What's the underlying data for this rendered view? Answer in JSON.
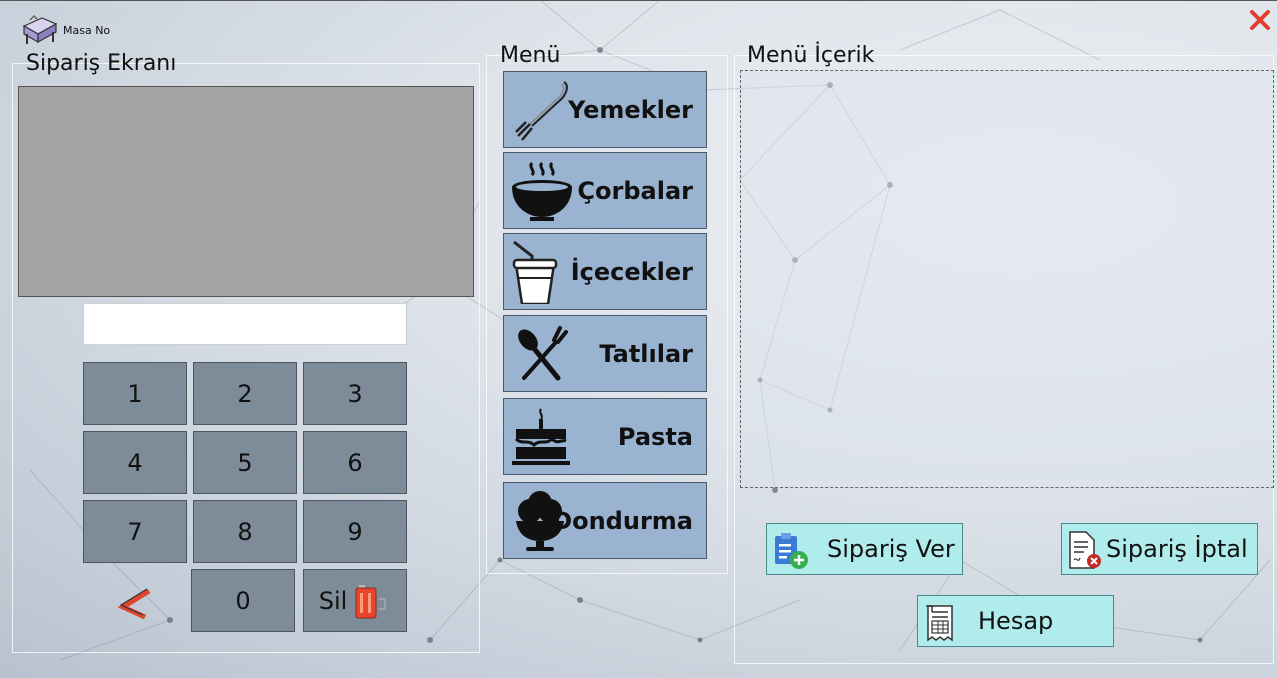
{
  "window": {
    "table_label": "Masa No",
    "close_icon": "close-x-icon",
    "close_color": "#e53e2e"
  },
  "order_panel": {
    "title": "Sipariş Ekranı",
    "input_value": "",
    "keypad": [
      "1",
      "2",
      "3",
      "4",
      "5",
      "6",
      "7",
      "8",
      "9",
      "0"
    ],
    "delete_label": "Sil",
    "backspace_icon": "backspace-arrow-icon",
    "delete_icon": "trash-battery-icon"
  },
  "menu": {
    "title": "Menü",
    "items": [
      {
        "label": "Yemekler",
        "icon": "fork-icon"
      },
      {
        "label": "Çorbalar",
        "icon": "soup-bowl-icon"
      },
      {
        "label": "İçecekler",
        "icon": "drink-cup-icon"
      },
      {
        "label": "Tatlılar",
        "icon": "crossed-cutlery-icon"
      },
      {
        "label": "Pasta",
        "icon": "cake-icon"
      },
      {
        "label": "Dondurma",
        "icon": "ice-cream-icon"
      }
    ]
  },
  "menu_content": {
    "title": "Menü İçerik"
  },
  "actions": {
    "place_order": "Sipariş Ver",
    "cancel_order": "Sipariş İptal",
    "bill": "Hesap"
  },
  "colors": {
    "keypad_button": "#7e8c99",
    "menu_button": "#9ab3d0",
    "action_button": "#b0ecec",
    "display_panel": "#a3a3a3"
  }
}
